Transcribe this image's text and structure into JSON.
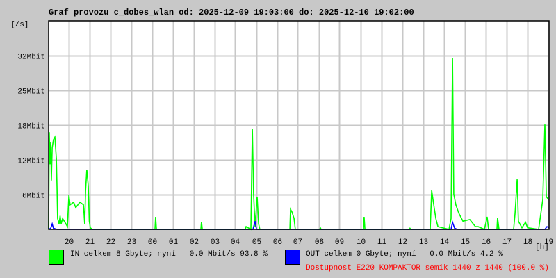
{
  "chart_data": {
    "type": "line",
    "title": "Graf provozu c_dobes_wlan od: 2025-12-09 19:03:00 do: 2025-12-10 19:02:00",
    "ylabel": "[/s]",
    "xlabel": "[h]",
    "xlim": [
      0,
      24
    ],
    "ylim": [
      0,
      38.4
    ],
    "grid": true,
    "x_ticks": [
      "20",
      "21",
      "22",
      "23",
      "00",
      "01",
      "02",
      "03",
      "04",
      "05",
      "06",
      "07",
      "08",
      "09",
      "10",
      "11",
      "12",
      "13",
      "14",
      "15",
      "16",
      "17",
      "18",
      "19"
    ],
    "y_ticks": [
      {
        "label": "6Mbit",
        "value": 6.4
      },
      {
        "label": "12Mbit",
        "value": 12.8
      },
      {
        "label": "18Mbit",
        "value": 19.2
      },
      {
        "label": "25Mbit",
        "value": 25.6
      },
      {
        "label": "32Mbit",
        "value": 32
      }
    ],
    "x_unit": "hours since 19:03",
    "y_unit": "Mbit/s",
    "series": [
      {
        "name": "IN",
        "color": "#00ff00",
        "points": [
          [
            0,
            0
          ],
          [
            0.03,
            17.9
          ],
          [
            0.07,
            12
          ],
          [
            0.1,
            16
          ],
          [
            0.13,
            9
          ],
          [
            0.17,
            15
          ],
          [
            0.23,
            16.5
          ],
          [
            0.3,
            17
          ],
          [
            0.37,
            13
          ],
          [
            0.4,
            8
          ],
          [
            0.43,
            2
          ],
          [
            0.5,
            1
          ],
          [
            0.55,
            2.5
          ],
          [
            0.6,
            1
          ],
          [
            0.67,
            2
          ],
          [
            0.75,
            1.5
          ],
          [
            0.83,
            1
          ],
          [
            0.9,
            0.5
          ],
          [
            0.97,
            6.3
          ],
          [
            1.03,
            4.5
          ],
          [
            1.2,
            5
          ],
          [
            1.3,
            4
          ],
          [
            1.5,
            5
          ],
          [
            1.67,
            4.5
          ],
          [
            1.73,
            1
          ],
          [
            1.77,
            7
          ],
          [
            1.83,
            11
          ],
          [
            1.9,
            8
          ],
          [
            1.95,
            1.5
          ],
          [
            2.0,
            0.3
          ],
          [
            2.1,
            0
          ],
          [
            5.1,
            0
          ],
          [
            5.13,
            2.3
          ],
          [
            5.17,
            0
          ],
          [
            7.3,
            0
          ],
          [
            7.33,
            1.4
          ],
          [
            7.37,
            0
          ],
          [
            9.43,
            0
          ],
          [
            9.47,
            0.5
          ],
          [
            9.7,
            0
          ],
          [
            9.77,
            18.5
          ],
          [
            9.83,
            6.5
          ],
          [
            9.9,
            0.5
          ],
          [
            10.0,
            6
          ],
          [
            10.07,
            1
          ],
          [
            10.13,
            0
          ],
          [
            11.57,
            0
          ],
          [
            11.6,
            3.7
          ],
          [
            11.67,
            3.2
          ],
          [
            11.77,
            2
          ],
          [
            11.83,
            0
          ],
          [
            13.0,
            0
          ],
          [
            13.03,
            0.3
          ],
          [
            13.07,
            0
          ],
          [
            15.1,
            0
          ],
          [
            15.13,
            2.3
          ],
          [
            15.17,
            0
          ],
          [
            17.3,
            0
          ],
          [
            17.33,
            0.2
          ],
          [
            17.37,
            0
          ],
          [
            18.3,
            0
          ],
          [
            18.37,
            7.2
          ],
          [
            18.47,
            4.5
          ],
          [
            18.57,
            2
          ],
          [
            18.67,
            0.5
          ],
          [
            19.2,
            0
          ],
          [
            19.3,
            2
          ],
          [
            19.37,
            31.5
          ],
          [
            19.43,
            6.5
          ],
          [
            19.53,
            4.5
          ],
          [
            19.67,
            3
          ],
          [
            19.87,
            1.5
          ],
          [
            20.2,
            1.8
          ],
          [
            20.47,
            0.5
          ],
          [
            20.6,
            0.5
          ],
          [
            20.9,
            0
          ],
          [
            21.03,
            2.3
          ],
          [
            21.1,
            0
          ],
          [
            21.5,
            0
          ],
          [
            21.53,
            2.1
          ],
          [
            21.6,
            0
          ],
          [
            22.3,
            0
          ],
          [
            22.37,
            3
          ],
          [
            22.47,
            9.2
          ],
          [
            22.53,
            1.5
          ],
          [
            22.7,
            0.3
          ],
          [
            22.87,
            1.3
          ],
          [
            22.97,
            0.3
          ],
          [
            23.5,
            0
          ],
          [
            23.7,
            5.5
          ],
          [
            23.8,
            19.3
          ],
          [
            23.87,
            6
          ],
          [
            23.97,
            5.5
          ],
          [
            24,
            5.5
          ]
        ]
      },
      {
        "name": "OUT",
        "color": "#0000ff",
        "points": [
          [
            0,
            0
          ],
          [
            0.1,
            0.2
          ],
          [
            0.17,
            1
          ],
          [
            0.23,
            0.2
          ],
          [
            0.4,
            0
          ],
          [
            9.8,
            0
          ],
          [
            9.9,
            1.5
          ],
          [
            9.97,
            0
          ],
          [
            19.3,
            0
          ],
          [
            19.37,
            1.3
          ],
          [
            19.47,
            0.2
          ],
          [
            19.6,
            0
          ],
          [
            23.8,
            0
          ],
          [
            23.9,
            0.5
          ],
          [
            24,
            0.3
          ]
        ]
      }
    ]
  },
  "legend": {
    "in_text": "IN celkem 8 Gbyte; nyní   0.0 Mbit/s 93.8 %",
    "out_text": "OUT celkem 0 Gbyte; nyní   0.0 Mbit/s 4.2 %",
    "availability": "Dostupnost E220 KOMPAKTOR semik 1440 z 1440 (100.0 %)"
  }
}
